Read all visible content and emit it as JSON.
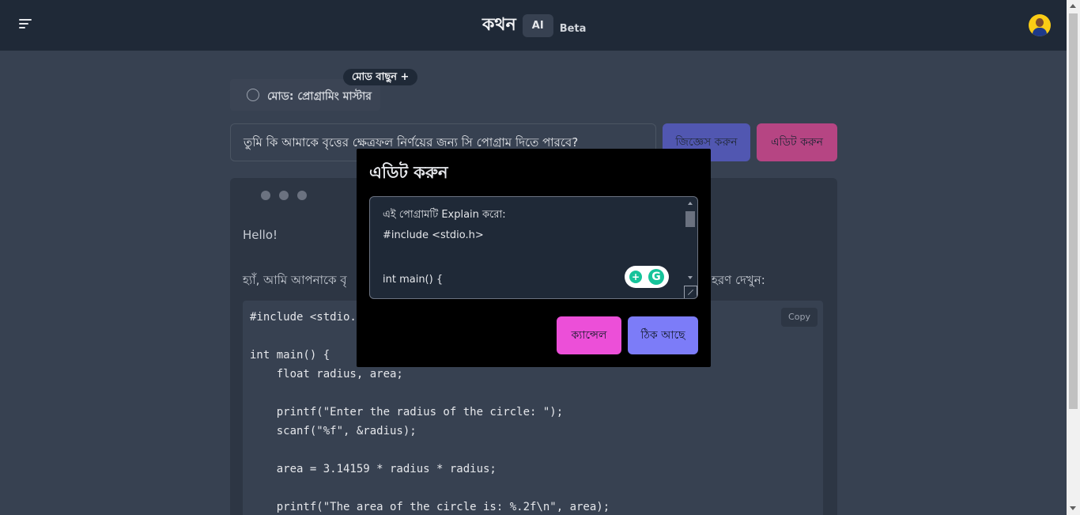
{
  "header": {
    "brand_name": "কথন",
    "brand_ai": "AI",
    "brand_beta": "Beta"
  },
  "mode": {
    "change_label": "মোড বাছুন +",
    "current_label": "মোড: প্রোগ্রামিং মাস্টার"
  },
  "question": {
    "value": "তুমি কি আমাকে বৃত্তের ক্ষেত্রফল নির্ণয়ের জন্য সি পোগ্রাম দিতে পারবে?",
    "ask_label": "জিজ্ঞেস করুন",
    "edit_label": "এডিট করুন"
  },
  "response": {
    "greeting": "Hello!",
    "intro_start": "হ্যাঁ, আমি আপনাকে বৃ",
    "intro_end": "হরণ দেখুন:",
    "copy_label": "Copy",
    "code": "#include <stdio.h>\n\nint main() {\n    float radius, area;\n\n    printf(\"Enter the radius of the circle: \");\n    scanf(\"%f\", &radius);\n\n    area = 3.14159 * radius * radius;\n\n    printf(\"The area of the circle is: %.2f\\n\", area);"
  },
  "modal": {
    "title": "এডিট করুন",
    "lines": [
      "এই পোগ্রামটি Explain করো:",
      "#include <stdio.h>",
      "",
      "int main() {"
    ],
    "cancel_label": "ক্যান্সেল",
    "ok_label": "ঠিক আছে"
  },
  "icons": {
    "menu": "menu-icon",
    "grammarly": "grammarly-icon"
  },
  "colors": {
    "header_bg": "#1f2937",
    "page_bg": "#374151",
    "ask": "#6366f1",
    "edit": "#ec4899",
    "cancel": "#ec4fd8",
    "ok": "#7c7cf8"
  }
}
